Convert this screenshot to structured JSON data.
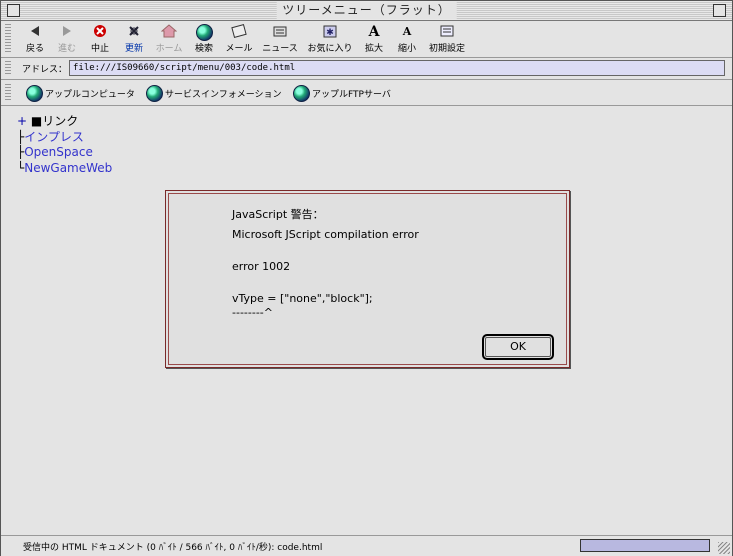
{
  "window": {
    "title": "ツリーメニュー（フラット）"
  },
  "toolbar": {
    "buttons": [
      {
        "label": "戻る",
        "icon": "back-arrow-icon"
      },
      {
        "label": "進む",
        "icon": "forward-arrow-icon"
      },
      {
        "label": "中止",
        "icon": "stop-icon"
      },
      {
        "label": "更新",
        "icon": "refresh-icon"
      },
      {
        "label": "ホーム",
        "icon": "home-icon"
      },
      {
        "label": "検索",
        "icon": "search-globe-icon"
      },
      {
        "label": "メール",
        "icon": "mail-icon"
      },
      {
        "label": "ニュース",
        "icon": "news-icon"
      },
      {
        "label": "お気に入り",
        "icon": "favorites-icon"
      },
      {
        "label": "拡大",
        "icon": "font-larger-icon"
      },
      {
        "label": "縮小",
        "icon": "font-smaller-icon"
      },
      {
        "label": "初期設定",
        "icon": "preferences-icon"
      }
    ]
  },
  "address": {
    "label": "アドレス：",
    "value": "file:///IS09660/script/menu/003/code.html"
  },
  "links": [
    {
      "label": "アップルコンピュータ"
    },
    {
      "label": "サービスインフォメーション"
    },
    {
      "label": "アップルFTPサーバ"
    }
  ],
  "tree": {
    "root_marker": "+",
    "root_label": "■リンク",
    "items": [
      {
        "prefix": "├",
        "label": "インプレス"
      },
      {
        "prefix": "├",
        "label": "OpenSpace"
      },
      {
        "prefix": "└",
        "label": "NewGameWeb"
      }
    ]
  },
  "dialog": {
    "title": "JavaScript 警告：",
    "message": "Microsoft JScript compilation error",
    "error": "error 1002",
    "code": "vType = [\"none\",\"block\"];",
    "caret": "--------^",
    "ok_label": "OK"
  },
  "status": {
    "text": "受信中の HTML ドキュメント (0 ﾊﾞｲﾄ / 566 ﾊﾞｲﾄ, 0 ﾊﾞｲﾄ/秒): code.html",
    "progress": 1
  },
  "colors": {
    "address_bg": "#dcdcf4",
    "link_text": "#3333cc",
    "dialog_border": "#7a2a2a",
    "progress_fill": "#b8b8e0"
  }
}
